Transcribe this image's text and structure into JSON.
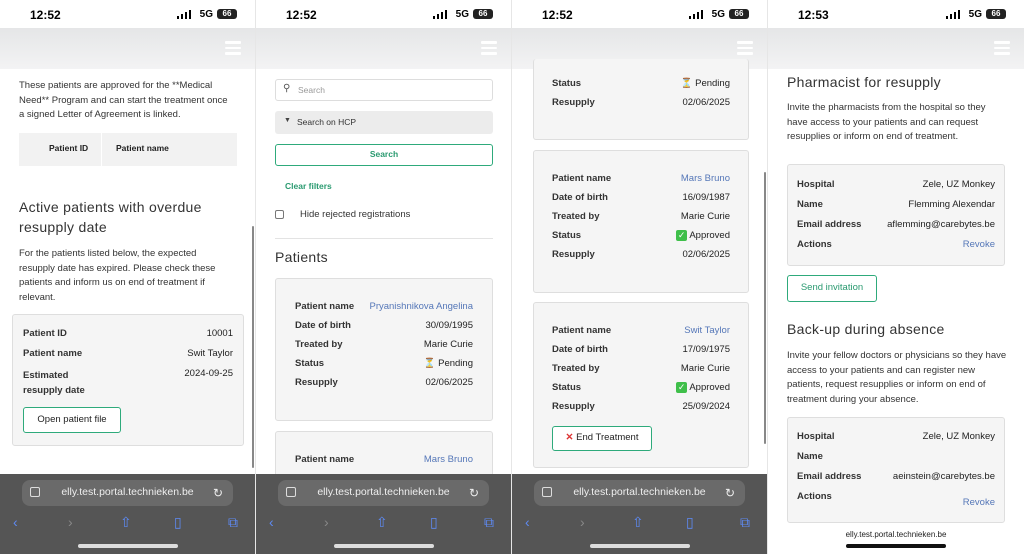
{
  "status_bar": [
    {
      "time": "12:52",
      "network": "5G",
      "battery": "66"
    },
    {
      "time": "12:52",
      "network": "5G",
      "battery": "66"
    },
    {
      "time": "12:52",
      "network": "5G",
      "battery": "66"
    },
    {
      "time": "12:53",
      "network": "5G",
      "battery": "66"
    }
  ],
  "browser": {
    "url": "elly.test.portal.technieken.be",
    "reload_icon": "reload-icon",
    "nav_icons": [
      "back-icon",
      "forward-icon",
      "share-icon",
      "bookmarks-icon",
      "tabs-icon"
    ]
  },
  "screen1": {
    "approved_text": "These patients are approved for the **Medical Need** Program and can start the treatment once a signed Letter of Agreement is linked.",
    "table_headers": [
      "Patient ID",
      "Patient name"
    ],
    "overdue_title": "Active patients with overdue resupply date",
    "overdue_text": "For the patients listed below, the expected resupply date has expired. Please check these patients and inform us on end of treatment if relevant.",
    "card": {
      "id_label": "Patient ID",
      "id_value": "10001",
      "name_label": "Patient name",
      "name_value": "Swit Taylor",
      "est_label_1": "Estimated",
      "est_label_2": "resupply date",
      "est_value": "2024-09-25",
      "open_button": "Open patient file"
    }
  },
  "screen2": {
    "search_placeholder": "Search",
    "search_hcp": "Search on HCP",
    "search_button": "Search",
    "clear_filters": "Clear filters",
    "hide_rejected": "Hide rejected registrations",
    "patients_title": "Patients",
    "labels": {
      "name": "Patient name",
      "dob": "Date of birth",
      "treated": "Treated by",
      "status": "Status",
      "resupply": "Resupply"
    },
    "card1": {
      "name": "Pryanishnikova Angelina",
      "dob": "30/09/1995",
      "treated": "Marie Curie",
      "status": "Pending",
      "resupply": "02/06/2025"
    },
    "card2": {
      "name": "Mars Bruno"
    }
  },
  "screen3": {
    "labels": {
      "name": "Patient name",
      "dob": "Date of birth",
      "treated": "Treated by",
      "status": "Status",
      "resupply": "Resupply"
    },
    "card0": {
      "status": "Pending",
      "resupply": "02/06/2025"
    },
    "card1": {
      "name": "Mars Bruno",
      "dob": "16/09/1987",
      "treated": "Marie Curie",
      "status": "Approved",
      "resupply": "02/06/2025"
    },
    "card2": {
      "name": "Swit Taylor",
      "dob": "17/09/1975",
      "treated": "Marie Curie",
      "status": "Approved",
      "resupply": "25/09/2024"
    },
    "end_treatment": "End Treatment"
  },
  "screen4": {
    "pharm_title": "Pharmacist for resupply",
    "pharm_text": "Invite the pharmacists from the hospital so they have access to your patients and can request resupplies or inform on end of treatment.",
    "labels": {
      "hospital": "Hospital",
      "name": "Name",
      "email": "Email address",
      "actions": "Actions"
    },
    "pharm_card": {
      "hospital": "Zele, UZ Monkey",
      "name": "Flemming Alexendar",
      "email": "aflemming@carebytes.be",
      "action": "Revoke"
    },
    "send_invitation": "Send invitation",
    "backup_title": "Back-up during absence",
    "backup_text": "Invite your fellow doctors or physicians so they have access to your patients and can register new patients, request resupplies or inform on end of treatment during your absence.",
    "backup_card": {
      "hospital": "Zele, UZ Monkey",
      "name": "",
      "email": "aeinstein@carebytes.be",
      "action": "Revoke"
    }
  }
}
